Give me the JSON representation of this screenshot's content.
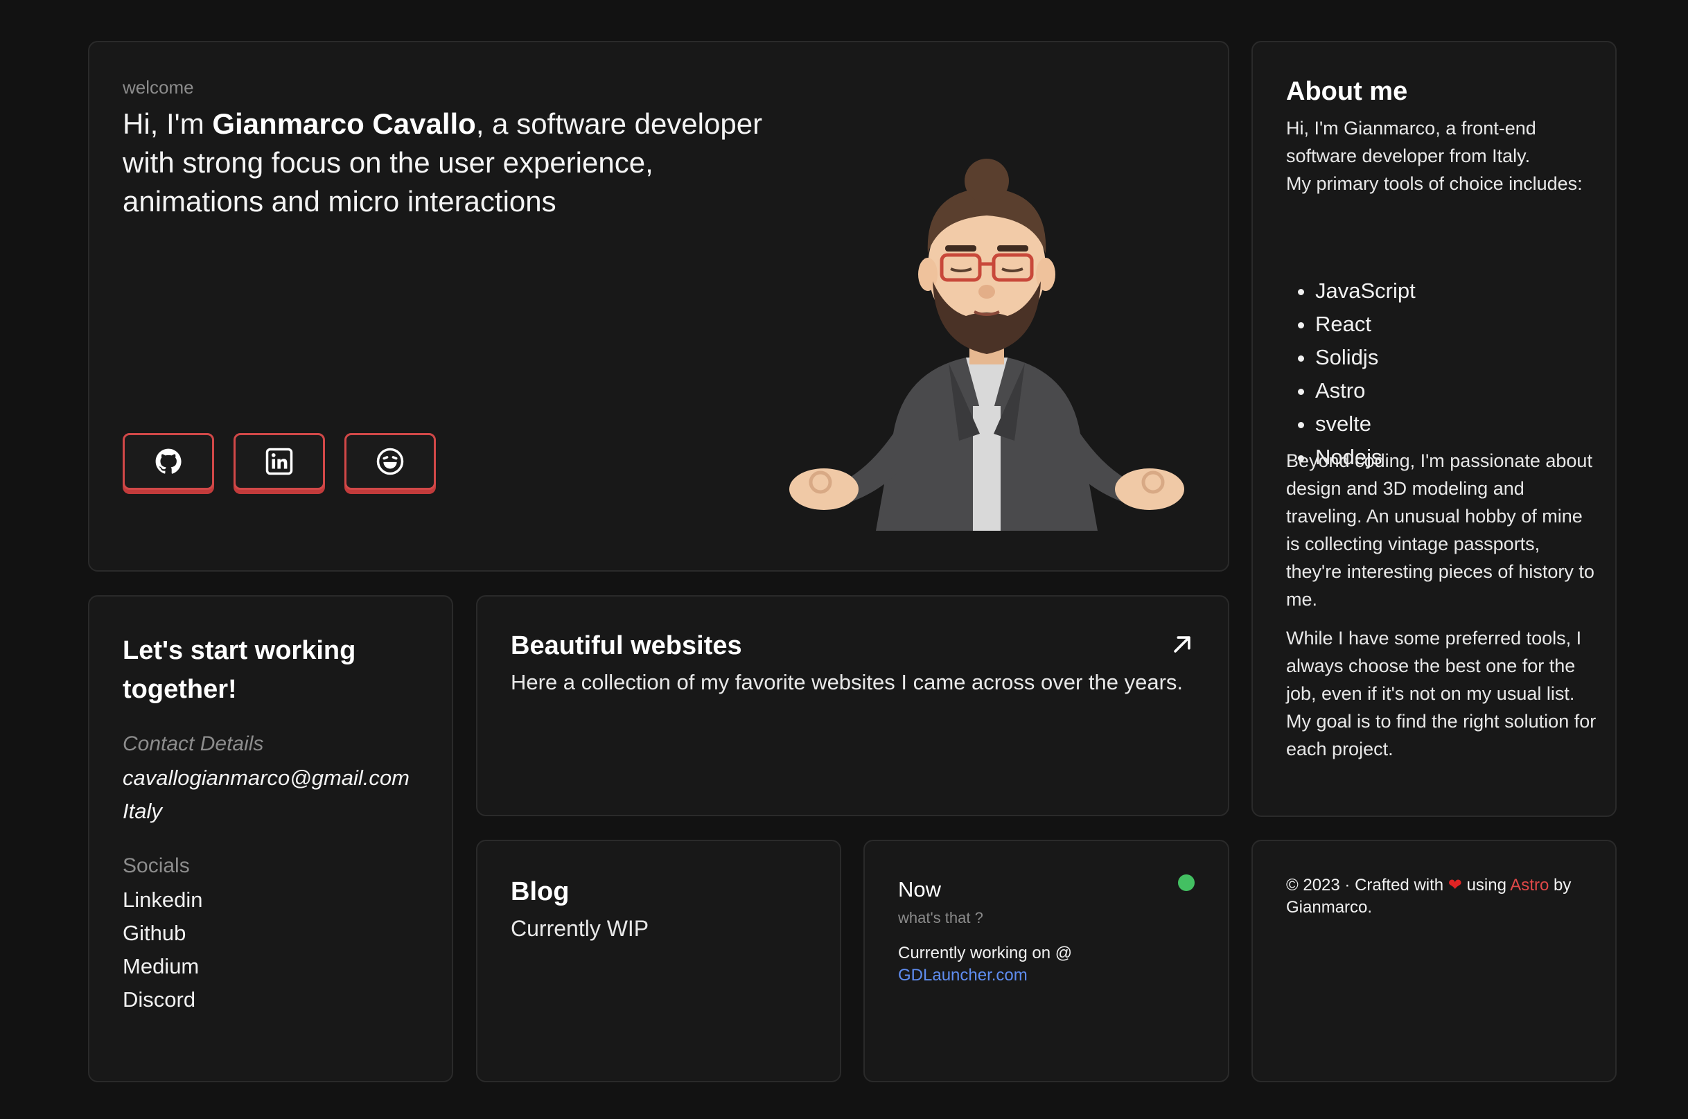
{
  "hero": {
    "welcome": "welcome",
    "intro_prefix": "Hi, I'm ",
    "name": "Gianmarco Cavallo",
    "intro_suffix": ", a software developer with strong focus on the user experience, animations and micro interactions",
    "socials": [
      {
        "name": "github",
        "icon": "github-icon"
      },
      {
        "name": "linkedin",
        "icon": "linkedin-icon"
      },
      {
        "name": "emoji",
        "icon": "laughing-face-icon"
      }
    ],
    "accent_color": "#d14848"
  },
  "about": {
    "title": "About me",
    "intro": "Hi, I'm Gianmarco, a front-end software developer from Italy.",
    "tools_intro": "My primary tools of choice includes:",
    "tools": [
      "JavaScript",
      "React",
      "Solidjs",
      "Astro",
      "svelte",
      "Nodejs"
    ],
    "para1": "Beyond coding, I'm passionate about design and 3D modeling and traveling. An unusual hobby of mine is collecting vintage passports, they're interesting pieces of history to me.",
    "para2": "While I have some preferred tools, I always choose the best one for the job, even if it's not on my usual list. My goal is to find the right solution for each project."
  },
  "contact": {
    "title": "Let's start working together!",
    "details_label": "Contact Details",
    "email": "cavallogianmarco@gmail.com",
    "country": "Italy",
    "socials_label": "Socials",
    "links": [
      "Linkedin",
      "Github",
      "Medium",
      "Discord"
    ]
  },
  "websites": {
    "title": "Beautiful websites",
    "description": "Here a collection of my favorite websites I came across over the years.",
    "arrow_icon": "arrow-up-right-icon"
  },
  "blog": {
    "title": "Blog",
    "status": "Currently WIP"
  },
  "now": {
    "title": "Now",
    "subtitle": "what's that ?",
    "text": "Currently working on @",
    "link": "GDLauncher.com",
    "status_color": "#43c062"
  },
  "footer": {
    "prefix": "© 2023 · Crafted with ",
    "heart": "❤",
    "using": " using ",
    "astro": "Astro",
    "suffix": " by Gianmarco."
  }
}
